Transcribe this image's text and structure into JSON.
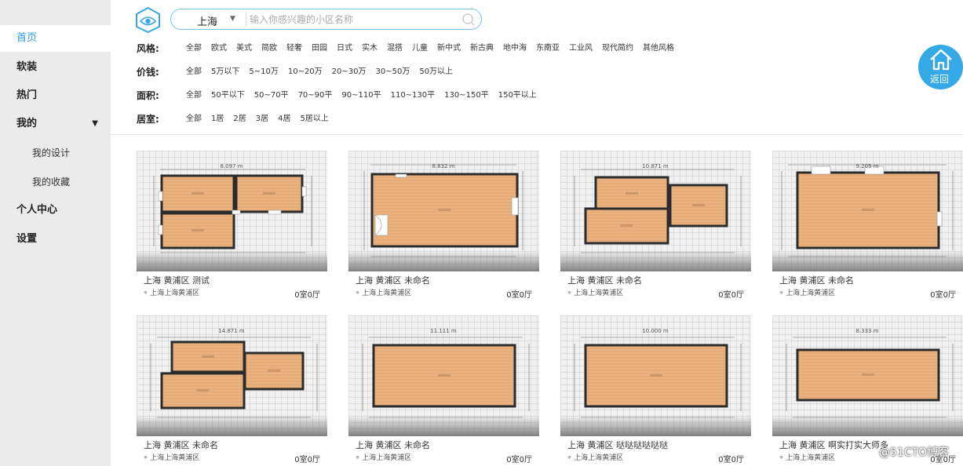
{
  "sidebar": {
    "items": [
      {
        "label": "首页",
        "active": true,
        "sub": false,
        "caret": false
      },
      {
        "label": "软装",
        "active": false,
        "sub": false,
        "caret": false
      },
      {
        "label": "热门",
        "active": false,
        "sub": false,
        "caret": false
      },
      {
        "label": "我的",
        "active": false,
        "sub": false,
        "caret": true
      },
      {
        "label": "我的设计",
        "active": false,
        "sub": true,
        "caret": false
      },
      {
        "label": "我的收藏",
        "active": false,
        "sub": true,
        "caret": false
      },
      {
        "label": "个人中心",
        "active": false,
        "sub": false,
        "caret": false
      },
      {
        "label": "设置",
        "active": false,
        "sub": false,
        "caret": false
      }
    ]
  },
  "header": {
    "logo_icon": "eye-house-logo-icon",
    "city": "上海",
    "search_placeholder": "输入你感兴趣的小区名称",
    "search_value": ""
  },
  "filters": [
    {
      "label": "风格:",
      "options": [
        "全部",
        "欧式",
        "美式",
        "简欧",
        "轻奢",
        "田园",
        "日式",
        "实木",
        "混搭",
        "儿童",
        "新中式",
        "新古典",
        "地中海",
        "东南亚",
        "工业风",
        "现代简约",
        "其他风格"
      ]
    },
    {
      "label": "价钱:",
      "options": [
        "全部",
        "5万以下",
        "5~10万",
        "10~20万",
        "20~30万",
        "30~50万",
        "50万以上"
      ]
    },
    {
      "label": "面积:",
      "options": [
        "全部",
        "50平以下",
        "50~70平",
        "70~90平",
        "90~110平",
        "110~130平",
        "130~150平",
        "150平以上"
      ]
    },
    {
      "label": "居室:",
      "options": [
        "全部",
        "1居",
        "2居",
        "3居",
        "4居",
        "5居以上"
      ]
    }
  ],
  "back_button": {
    "label": "返回",
    "icon": "home-icon"
  },
  "cards": [
    {
      "title": "上海 黄浦区 测试",
      "address": "上海上海黄浦区",
      "rooms": "0室0厅",
      "plan": "three-rooms",
      "dim": "8.097 m"
    },
    {
      "title": "上海 黄浦区 未命名",
      "address": "上海上海黄浦区",
      "rooms": "0室0厅",
      "plan": "big-room-door",
      "dim": "8.832 m"
    },
    {
      "title": "上海 黄浦区 未命名",
      "address": "上海上海黄浦区",
      "rooms": "0室0厅",
      "plan": "two-left-one-right",
      "dim": "10.871 m"
    },
    {
      "title": "上海 黄浦区 未命名",
      "address": "上海上海黄浦区",
      "rooms": "0室0厅",
      "plan": "big-room-windows",
      "dim": "9.205 m"
    },
    {
      "title": "上海 黄浦区 未命名",
      "address": "上海上海黄浦区",
      "rooms": "0室0厅",
      "plan": "two-left-one-right-b",
      "dim": "14.871 m"
    },
    {
      "title": "上海 黄浦区 未命名",
      "address": "上海上海黄浦区",
      "rooms": "0室0厅",
      "plan": "big-rect",
      "dim": "11.111 m"
    },
    {
      "title": "上海 黄浦区 哒哒哒哒哒哒",
      "address": "上海上海黄浦区",
      "rooms": "0室0厅",
      "plan": "mid-rect",
      "dim": "10.000 m"
    },
    {
      "title": "上海 黄浦区 啊实打实大师多",
      "address": "上海上海黄浦区",
      "rooms": "0室0厅",
      "plan": "wide-short",
      "dim": "8.333 m"
    }
  ],
  "watermark": "@51CTO博客",
  "colors": {
    "accent": "#2a9be0",
    "floor": "#e9b27f",
    "wall": "#2b2b2b",
    "back_button": "#35a9e6"
  }
}
